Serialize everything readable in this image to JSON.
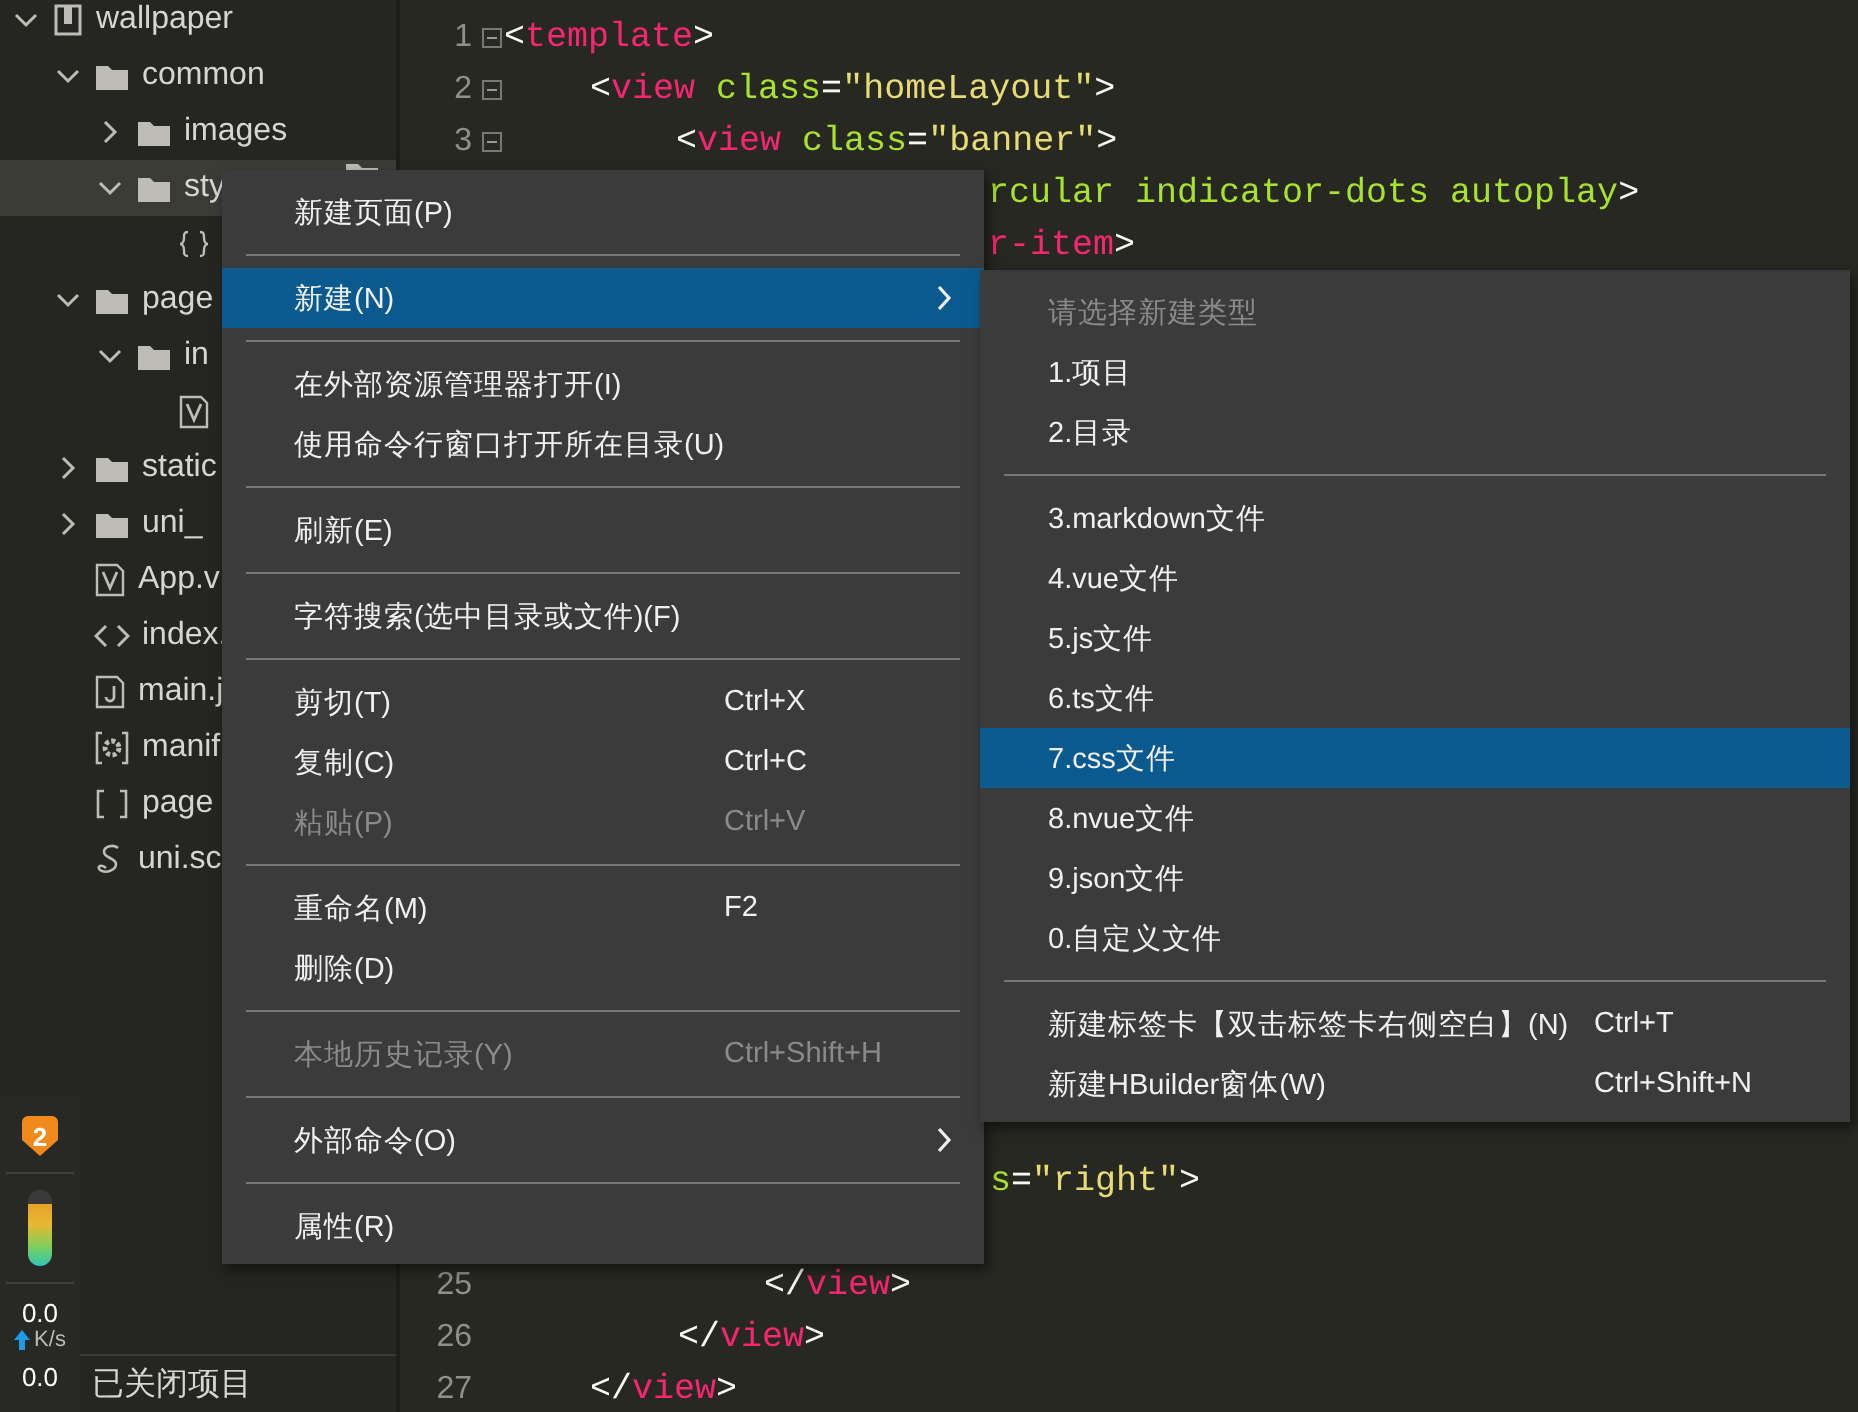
{
  "sidebar": {
    "tree": [
      {
        "label": "wallpaper",
        "kind": "project",
        "expanded": true,
        "selected": false,
        "children": [
          {
            "label": "common",
            "kind": "folder",
            "expanded": true,
            "selected": false,
            "children": [
              {
                "label": "images",
                "kind": "folder",
                "expanded": false,
                "selected": false
              },
              {
                "label": "sty",
                "kind": "folder",
                "expanded": true,
                "selected": true,
                "children": [
                  {
                    "kind": "file-braces",
                    "selected": false
                  }
                ]
              }
            ]
          },
          {
            "label": "page",
            "kind": "folder",
            "expanded": true,
            "selected": false,
            "children": [
              {
                "label": "in",
                "kind": "folder",
                "expanded": true,
                "selected": false,
                "children": [
                  {
                    "kind": "file-vue",
                    "selected": false
                  }
                ]
              }
            ]
          },
          {
            "label": "static",
            "kind": "folder",
            "expanded": false,
            "selected": false
          },
          {
            "label": "uni_",
            "kind": "folder",
            "expanded": false,
            "selected": false
          },
          {
            "label": "App.v",
            "kind": "file-vue",
            "selected": false
          },
          {
            "label": "index.",
            "kind": "file-tag",
            "selected": false
          },
          {
            "label": "main.j",
            "kind": "file-js",
            "selected": false
          },
          {
            "label": "manif",
            "kind": "file-gear",
            "selected": false
          },
          {
            "label": "page",
            "kind": "file-brackets",
            "selected": false
          },
          {
            "label": "uni.sc",
            "kind": "file-swirl",
            "selected": false
          }
        ]
      }
    ],
    "closed_projects": "已关闭项目"
  },
  "monitor": {
    "badge": "2",
    "upload": "0.0",
    "unit": "K/s",
    "download": "0.0"
  },
  "editor": {
    "lines": [
      {
        "number": "1",
        "fold": true,
        "tokens": [
          {
            "kind": "punct",
            "text": "<"
          },
          {
            "kind": "tag",
            "text": "template"
          },
          {
            "kind": "punct",
            "text": ">"
          }
        ]
      },
      {
        "number": "2",
        "fold": true,
        "tokens": [
          {
            "kind": "punct",
            "text": "<"
          },
          {
            "kind": "tag",
            "text": "view"
          },
          {
            "kind": "attr",
            "text": " class"
          },
          {
            "kind": "punct",
            "text": "="
          },
          {
            "kind": "string",
            "text": "\"homeLayout\""
          },
          {
            "kind": "punct",
            "text": ">"
          }
        ]
      },
      {
        "number": "3",
        "fold": true,
        "tokens": [
          {
            "kind": "punct",
            "text": "<"
          },
          {
            "kind": "tag",
            "text": "view"
          },
          {
            "kind": "attr",
            "text": " class"
          },
          {
            "kind": "punct",
            "text": "="
          },
          {
            "kind": "string",
            "text": "\"banner\""
          },
          {
            "kind": "punct",
            "text": ">"
          }
        ]
      },
      {
        "tokens": [
          {
            "kind": "attr",
            "text": "rcular indicator-dots autoplay"
          },
          {
            "kind": "punct",
            "text": ">"
          }
        ]
      },
      {
        "tokens": [
          {
            "kind": "tag",
            "text": "r-item"
          },
          {
            "kind": "punct",
            "text": ">"
          }
        ]
      },
      {
        "tokens": [
          {
            "kind": "attr",
            "text": "s"
          },
          {
            "kind": "punct",
            "text": "="
          },
          {
            "kind": "string",
            "text": "\"right\""
          },
          {
            "kind": "punct",
            "text": ">"
          }
        ]
      },
      {
        "number": "25",
        "tokens": [
          {
            "kind": "punct",
            "text": "</"
          },
          {
            "kind": "tag",
            "text": "view"
          },
          {
            "kind": "punct",
            "text": ">"
          }
        ]
      },
      {
        "number": "26",
        "tokens": [
          {
            "kind": "punct",
            "text": "</"
          },
          {
            "kind": "tag",
            "text": "view"
          },
          {
            "kind": "punct",
            "text": ">"
          }
        ]
      },
      {
        "number": "27",
        "tokens": [
          {
            "kind": "punct",
            "text": "</"
          },
          {
            "kind": "tag",
            "text": "view"
          },
          {
            "kind": "punct",
            "text": ">"
          }
        ]
      }
    ]
  },
  "context_menu": {
    "items": [
      {
        "kind": "item",
        "label": "新建页面(P)",
        "disabled": false,
        "selected": false,
        "submenu": false
      },
      {
        "kind": "separator"
      },
      {
        "kind": "item",
        "label": "新建(N)",
        "disabled": false,
        "selected": true,
        "submenu": true
      },
      {
        "kind": "separator"
      },
      {
        "kind": "item",
        "label": "在外部资源管理器打开(I)",
        "disabled": false,
        "selected": false,
        "submenu": false
      },
      {
        "kind": "item",
        "label": "使用命令行窗口打开所在目录(U)",
        "disabled": false,
        "selected": false,
        "submenu": false
      },
      {
        "kind": "separator"
      },
      {
        "kind": "item",
        "label": "刷新(E)",
        "disabled": false,
        "selected": false,
        "submenu": false
      },
      {
        "kind": "separator"
      },
      {
        "kind": "item",
        "label": "字符搜索(选中目录或文件)(F)",
        "disabled": false,
        "selected": false,
        "submenu": false
      },
      {
        "kind": "separator"
      },
      {
        "kind": "item",
        "label": "剪切(T)",
        "shortcut": "Ctrl+X",
        "disabled": false,
        "selected": false,
        "submenu": false
      },
      {
        "kind": "item",
        "label": "复制(C)",
        "shortcut": "Ctrl+C",
        "disabled": false,
        "selected": false,
        "submenu": false
      },
      {
        "kind": "item",
        "label": "粘贴(P)",
        "shortcut": "Ctrl+V",
        "disabled": true,
        "selected": false,
        "submenu": false
      },
      {
        "kind": "separator"
      },
      {
        "kind": "item",
        "label": "重命名(M)",
        "shortcut": "F2",
        "disabled": false,
        "selected": false,
        "submenu": false
      },
      {
        "kind": "item",
        "label": "删除(D)",
        "disabled": false,
        "selected": false,
        "submenu": false
      },
      {
        "kind": "separator"
      },
      {
        "kind": "item",
        "label": "本地历史记录(Y)",
        "shortcut": "Ctrl+Shift+H",
        "disabled": true,
        "selected": false,
        "submenu": false
      },
      {
        "kind": "separator"
      },
      {
        "kind": "item",
        "label": "外部命令(O)",
        "disabled": false,
        "selected": false,
        "submenu": true
      },
      {
        "kind": "separator"
      },
      {
        "kind": "item",
        "label": "属性(R)",
        "disabled": false,
        "selected": false,
        "submenu": false
      }
    ]
  },
  "submenu": {
    "items": [
      {
        "kind": "item",
        "label": "请选择新建类型",
        "disabled": true,
        "selected": false
      },
      {
        "kind": "item",
        "label": "1.项目",
        "disabled": false,
        "selected": false
      },
      {
        "kind": "item",
        "label": "2.目录",
        "disabled": false,
        "selected": false
      },
      {
        "kind": "separator"
      },
      {
        "kind": "item",
        "label": "3.markdown文件",
        "disabled": false,
        "selected": false
      },
      {
        "kind": "item",
        "label": "4.vue文件",
        "disabled": false,
        "selected": false
      },
      {
        "kind": "item",
        "label": "5.js文件",
        "disabled": false,
        "selected": false
      },
      {
        "kind": "item",
        "label": "6.ts文件",
        "disabled": false,
        "selected": false
      },
      {
        "kind": "item",
        "label": "7.css文件",
        "disabled": false,
        "selected": true
      },
      {
        "kind": "item",
        "label": "8.nvue文件",
        "disabled": false,
        "selected": false
      },
      {
        "kind": "item",
        "label": "9.json文件",
        "disabled": false,
        "selected": false
      },
      {
        "kind": "item",
        "label": "0.自定义文件",
        "disabled": false,
        "selected": false
      },
      {
        "kind": "separator"
      },
      {
        "kind": "item",
        "label": "新建标签卡【双击标签卡右侧空白】(N)",
        "shortcut": "Ctrl+T",
        "disabled": false,
        "selected": false
      },
      {
        "kind": "item",
        "label": "新建HBuilder窗体(W)",
        "shortcut": "Ctrl+Shift+N",
        "disabled": false,
        "selected": false
      }
    ]
  }
}
